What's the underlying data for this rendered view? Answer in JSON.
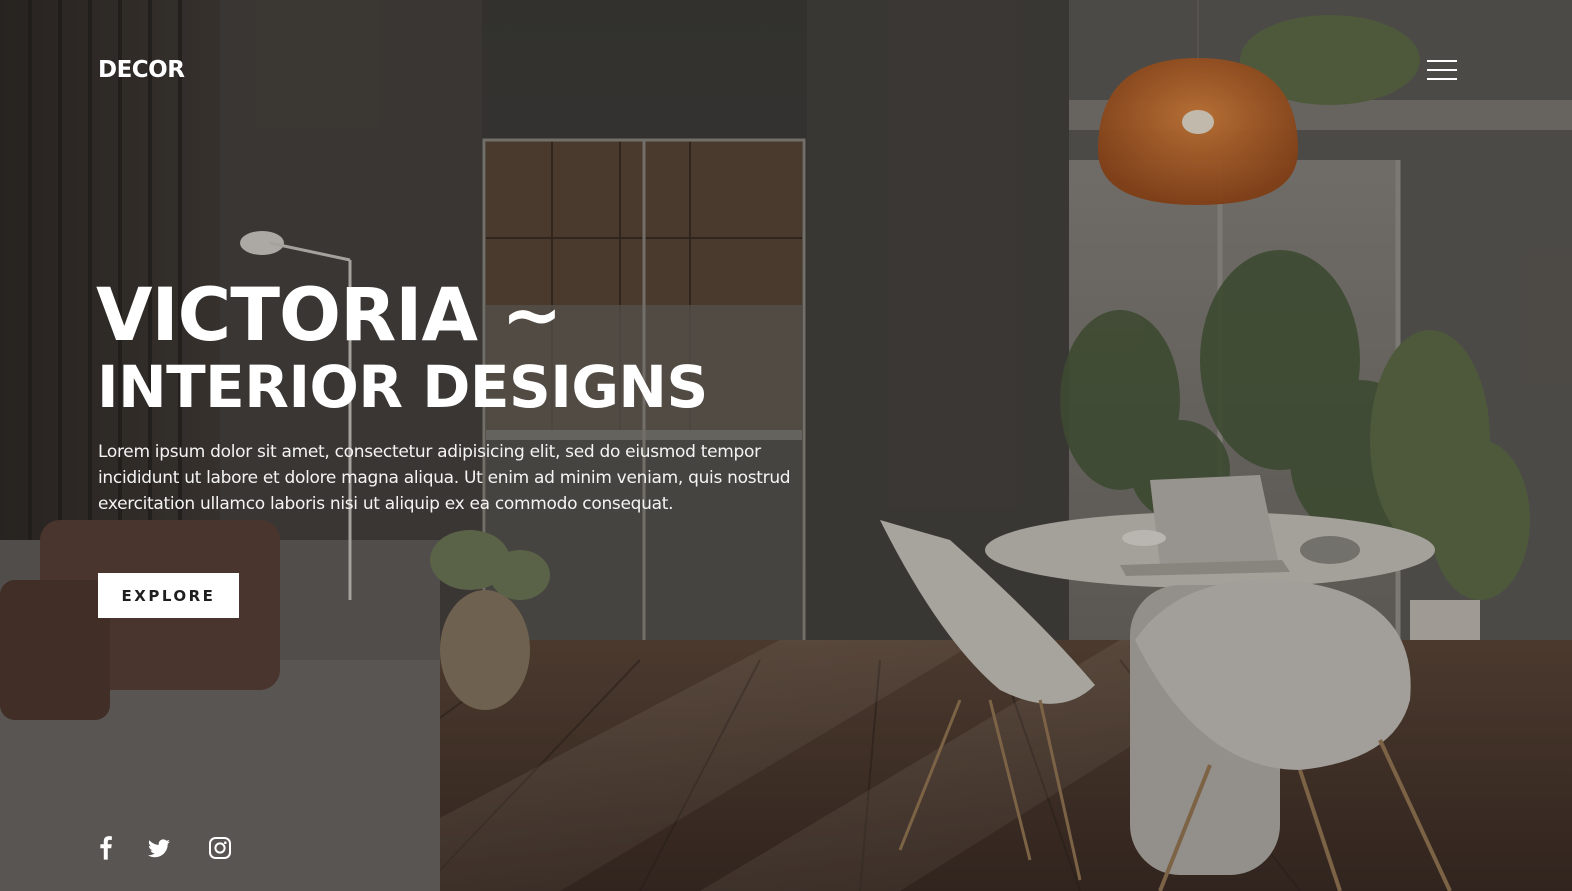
{
  "header": {
    "logo": "DECOR",
    "menu_icon": "hamburger-menu-icon"
  },
  "hero": {
    "title_line1": "VICTORIA ~",
    "title_line2": "INTERIOR DESIGNS",
    "description": "Lorem ipsum dolor sit amet, consectetur adipisicing elit, sed do eiusmod tempor incididunt ut labore et dolore magna aliqua. Ut enim ad minim veniam, quis nostrud exercitation ullamco laboris nisi ut aliquip ex ea commodo consequat.",
    "cta_label": "EXPLORE"
  },
  "social": {
    "icons": [
      "facebook-icon",
      "twitter-icon",
      "instagram-icon"
    ]
  },
  "colors": {
    "text": "#ffffff",
    "button_bg": "#ffffff",
    "button_text": "#1e1e1e",
    "lamp_accent": "#c8621f"
  }
}
